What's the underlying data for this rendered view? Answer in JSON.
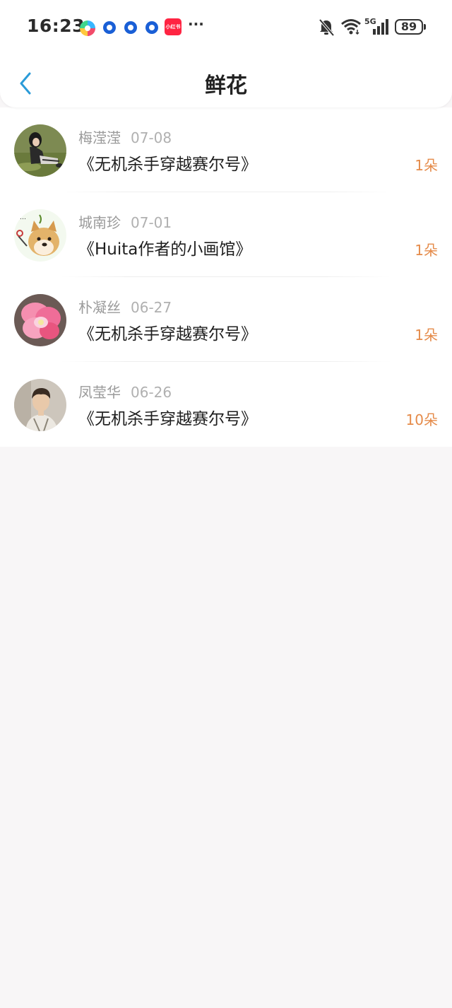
{
  "status_bar": {
    "time": "16:23",
    "battery": "89",
    "network": "5G",
    "more": "···",
    "badge_app_label": "小红书",
    "icons": [
      "photos-app-icon",
      "circle-app-icon",
      "circle-app-icon",
      "circle-app-icon",
      "xiaohongshu-app-icon",
      "mute-bell-icon",
      "wifi-icon",
      "signal-icon",
      "battery-icon"
    ]
  },
  "nav": {
    "title": "鲜花",
    "back_icon": "chevron-left-icon"
  },
  "colors": {
    "accent": "#e58b4a",
    "back": "#2a9bd8",
    "background": "#f8f6f7"
  },
  "items": [
    {
      "name": "梅滢滢",
      "date": "07-08",
      "book": "《无机杀手穿越赛尔号》",
      "count": "1朵",
      "avatar": "girl-sitting-avatar"
    },
    {
      "name": "城南珍",
      "date": "07-01",
      "book": "《Huita作者的小画馆》",
      "count": "1朵",
      "avatar": "doge-avatar"
    },
    {
      "name": "朴凝丝",
      "date": "06-27",
      "book": "《无机杀手穿越赛尔号》",
      "count": "1朵",
      "avatar": "pink-flower-avatar"
    },
    {
      "name": "凤莹华",
      "date": "06-26",
      "book": "《无机杀手穿越赛尔号》",
      "count": "10朵",
      "avatar": "young-man-avatar"
    }
  ]
}
